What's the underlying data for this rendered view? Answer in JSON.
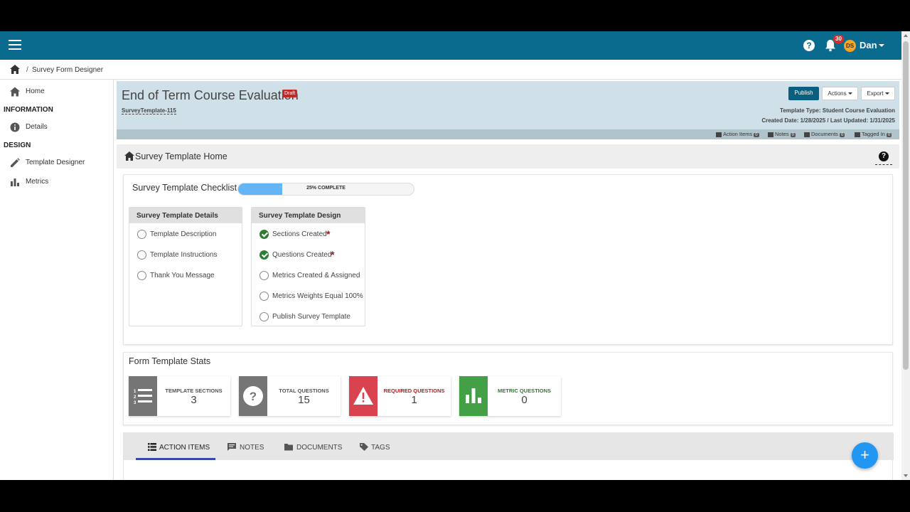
{
  "user": {
    "initials": "DS",
    "name": "Dan",
    "notification_count": "30",
    "avatar_color": "#f5a623"
  },
  "breadcrumb": {
    "separator": "/",
    "current": "Survey Form Designer"
  },
  "sidebar": {
    "home": "Home",
    "section_information": "INFORMATION",
    "details": "Details",
    "section_design": "DESIGN",
    "template_designer": "Template Designer",
    "metrics": "Metrics"
  },
  "header": {
    "title": "End of Term Course Evaluation",
    "status_badge": "Draft",
    "template_id": "SurveyTemplate-115",
    "publish_label": "Publish",
    "actions_label": "Actions",
    "export_label": "Export",
    "template_type": "Template Type: Student Course Evaluation",
    "dates": "Created Date: 1/28/2025 / Last Updated: 1/31/2025",
    "strip": {
      "action_items": {
        "label": "Action Items",
        "count": "0"
      },
      "notes": {
        "label": "Notes",
        "count": "0"
      },
      "documents": {
        "label": "Documents",
        "count": "0"
      },
      "tagged_in": {
        "label": "Tagged In",
        "count": "0"
      }
    }
  },
  "section": {
    "title": "Survey Template Home",
    "help": "?"
  },
  "checklist": {
    "title": "Survey Template Checklist",
    "progress_text": "25% COMPLETE",
    "progress_value": 0.25,
    "details_box": {
      "title": "Survey Template Details",
      "items": [
        {
          "label": "Template Description",
          "done": false
        },
        {
          "label": "Template Instructions",
          "done": false
        },
        {
          "label": "Thank You Message",
          "done": false
        }
      ]
    },
    "design_box": {
      "title": "Survey Template Design",
      "items": [
        {
          "label": "Sections Created",
          "done": true,
          "required": true
        },
        {
          "label": "Questions Created",
          "done": true,
          "required": true
        },
        {
          "label": "Metrics Created & Assigned",
          "done": false
        },
        {
          "label": "Metrics Weights Equal 100%",
          "done": false
        },
        {
          "label": "Publish Survey Template",
          "done": false
        }
      ]
    },
    "required_marker": "*"
  },
  "stats": {
    "title": "Form Template Stats",
    "tiles": [
      {
        "label": "TEMPLATE SECTIONS",
        "value": "3",
        "color": "#757575",
        "label_color": "#555555",
        "icon": "list-icon"
      },
      {
        "label": "TOTAL QUESTIONS",
        "value": "15",
        "color": "#757575",
        "label_color": "#555555",
        "icon": "question-icon"
      },
      {
        "label": "REQUIRED QUESTIONS",
        "value": "1",
        "color": "#d9434f",
        "label_color": "#b71c1c",
        "icon": "warning-icon"
      },
      {
        "label": "METRIC QUESTIONS",
        "value": "0",
        "color": "#43a047",
        "label_color": "#2e7d32",
        "icon": "bar-chart-icon"
      }
    ]
  },
  "tabs": [
    {
      "label": "ACTION ITEMS",
      "active": true
    },
    {
      "label": "NOTES",
      "active": false
    },
    {
      "label": "DOCUMENTS",
      "active": false
    },
    {
      "label": "TAGS",
      "active": false
    }
  ],
  "fab": {
    "label": "+"
  },
  "colors": {
    "topbar": "#0a6b8f",
    "header_card": "#cfe0e8",
    "publish": "#0a5e7e",
    "draft": "#c62828",
    "progress": "#64b5f6",
    "done": "#2e7d32",
    "fab": "#2196f3",
    "tab_active": "#3949ab"
  }
}
